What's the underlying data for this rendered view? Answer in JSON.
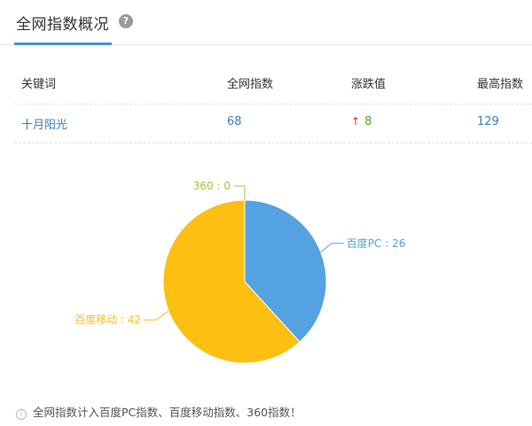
{
  "header": {
    "title": "全网指数概况",
    "help_glyph": "?"
  },
  "table": {
    "columns": [
      "关键词",
      "全网指数",
      "涨跌值",
      "最高指数"
    ],
    "rows": [
      {
        "keyword": "十月阳光",
        "index": "68",
        "change_arrow": "↑",
        "change": "8",
        "max": "129"
      }
    ]
  },
  "chart_data": {
    "type": "pie",
    "series": [
      {
        "name": "百度PC",
        "value": 26,
        "label": "百度PC : 26",
        "color": "#54a3e0"
      },
      {
        "name": "百度移动",
        "value": 42,
        "label": "百度移动 : 42",
        "color": "#fdbf11"
      },
      {
        "name": "360",
        "value": 0,
        "label": "360 : 0",
        "color": "#a4c639"
      }
    ]
  },
  "note": {
    "icon": "i",
    "text": "全网指数计入百度PC指数、百度移动指数、360指数！"
  }
}
